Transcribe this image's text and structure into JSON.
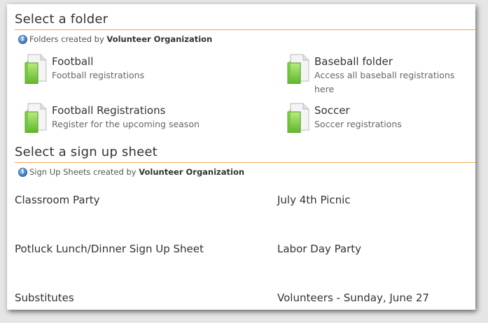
{
  "folders_section": {
    "title": "Select a folder",
    "info_prefix": "Folders created by ",
    "info_org": "Volunteer Organization",
    "items": [
      {
        "name": "Football",
        "description": "Football registrations"
      },
      {
        "name": "Baseball folder",
        "description": "Access all baseball registrations here"
      },
      {
        "name": "Football Registrations",
        "description": "Register for the upcoming season"
      },
      {
        "name": "Soccer",
        "description": "Soccer registrations"
      }
    ]
  },
  "sheets_section": {
    "title": "Select a sign up sheet",
    "info_prefix": "Sign Up Sheets created by ",
    "info_org": "Volunteer Organization",
    "items": [
      "Classroom Party",
      "July 4th Picnic",
      "Potluck Lunch/Dinner Sign Up Sheet",
      "Labor Day Party",
      "Substitutes",
      "Volunteers - Sunday, June 27"
    ]
  },
  "colors": {
    "accent_rule": "#f2a55a",
    "folder_green": "#7ccf3c",
    "info_blue": "#3a78c2"
  },
  "icons": {
    "folder": "green-folder-icon",
    "info": "info-icon"
  }
}
